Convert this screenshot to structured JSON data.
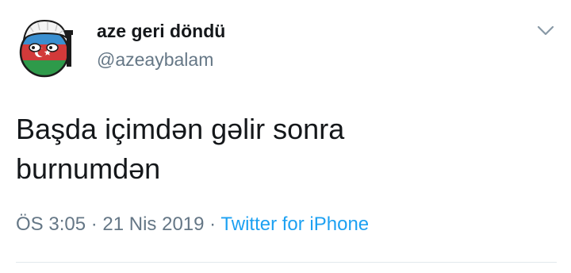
{
  "user": {
    "display_name": "aze geri döndü",
    "handle": "@azeaybalam",
    "avatar_icon": "azerbaijan-countryball-avatar"
  },
  "tweet": {
    "line1": "Başda içimdən gəlir sonra",
    "line2": "burnumdən"
  },
  "meta": {
    "time": "ÖS 3:05",
    "separator": "·",
    "date": "21 Nis 2019",
    "source": "Twitter for iPhone"
  },
  "icons": {
    "menu": "chevron-down-icon"
  },
  "colors": {
    "text": "#14171a",
    "secondary": "#657786",
    "link": "#1da1f2",
    "divider": "#e1e8ed"
  }
}
